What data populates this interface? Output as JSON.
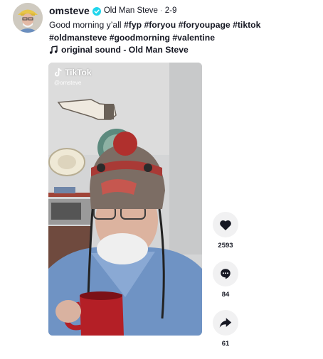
{
  "header": {
    "username": "omsteve",
    "nickname": "Old Man Steve",
    "separator": "·",
    "date": "2-9",
    "caption_text": "Good morning y’all",
    "hashtags": [
      "#fyp",
      "#foryou",
      "#foryoupage",
      "#tiktok",
      "#oldmansteve",
      "#goodmorning",
      "#valentine"
    ]
  },
  "music": {
    "label": "original sound - Old Man Steve"
  },
  "video": {
    "watermark_brand": "TikTok",
    "watermark_user": "@omsteve"
  },
  "actions": {
    "likes": "2593",
    "comments": "84",
    "shares": "61"
  },
  "colors": {
    "verified": "#20d5ec",
    "action_bg": "#f1f1f2",
    "text": "#161823"
  }
}
